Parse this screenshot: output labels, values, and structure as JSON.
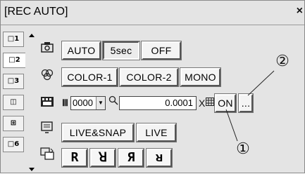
{
  "window": {
    "title": "[REC AUTO]",
    "close_label": "×"
  },
  "tabs": [
    {
      "label": "□1"
    },
    {
      "label": "□2"
    },
    {
      "label": "□3"
    },
    {
      "label": "◫"
    },
    {
      "label": "⊞"
    },
    {
      "label": "□6"
    }
  ],
  "rows": {
    "auto": {
      "icon": "camera-icon",
      "buttons": [
        "AUTO",
        "5sec",
        "OFF"
      ],
      "active": "5sec"
    },
    "color": {
      "icon": "color-mode-icon",
      "buttons": [
        "COLOR-1",
        "COLOR-2",
        "MONO"
      ]
    },
    "settings": {
      "icon": "film-icon",
      "combo_value": "0000",
      "number_value": "0.0001",
      "multiplier": "X",
      "on_label": "ON",
      "more_label": "..."
    },
    "live": {
      "icon": "monitor-icon",
      "buttons": [
        "LIVE&SNAP",
        "LIVE"
      ]
    },
    "orientation": {
      "icon": "rotate-icon",
      "buttons": [
        "R",
        "ꓤ",
        "Я",
        "ᴚ"
      ]
    }
  },
  "callouts": {
    "c1": "①",
    "c2": "②"
  }
}
